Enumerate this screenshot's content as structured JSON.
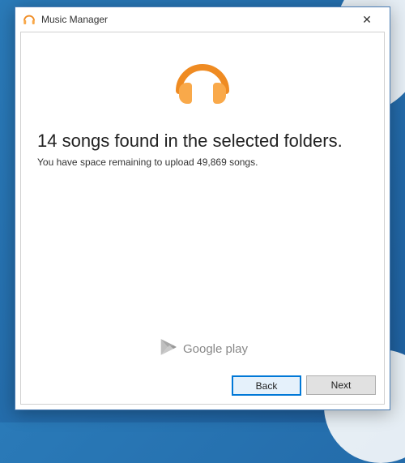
{
  "titlebar": {
    "title": "Music Manager",
    "close_symbol": "✕"
  },
  "main": {
    "headline": "14 songs found in the selected folders.",
    "subtext": "You have space remaining to upload 49,869 songs."
  },
  "footer": {
    "brand": "Google play"
  },
  "buttons": {
    "back": "Back",
    "next": "Next"
  },
  "icons": {
    "headphones": "headphones-icon",
    "play_triangle": "google-play-icon",
    "app_small": "music-manager-small-icon"
  },
  "colors": {
    "accent_orange": "#ef8b22",
    "accent_orange_light": "#f9a94a",
    "button_focus": "#0078d7"
  }
}
